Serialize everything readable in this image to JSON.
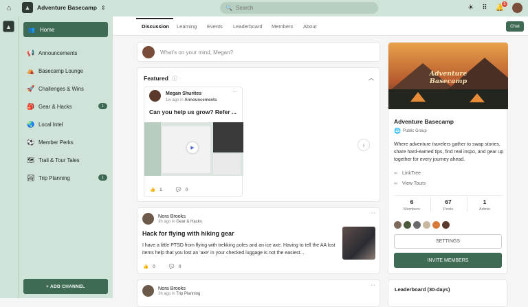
{
  "topbar": {
    "brand_title": "Adventure Basecamp",
    "search_placeholder": "Search",
    "notification_count": "5"
  },
  "sidebar": {
    "home_label": "Home",
    "items": [
      {
        "label": "Announcements",
        "icon": "megaphone-icon",
        "glyph": "📢",
        "count": ""
      },
      {
        "label": "Basecamp Lounge",
        "icon": "tent-icon",
        "glyph": "⛺",
        "count": ""
      },
      {
        "label": "Challenges & Wins",
        "icon": "rocket-icon",
        "glyph": "🚀",
        "count": ""
      },
      {
        "label": "Gear & Hacks",
        "icon": "backpack-icon",
        "glyph": "🎒",
        "count": "1"
      },
      {
        "label": "Local Intel",
        "icon": "globe-icon",
        "glyph": "🌏",
        "count": ""
      },
      {
        "label": "Member Perks",
        "icon": "soccer-ball-icon",
        "glyph": "⚽",
        "count": ""
      },
      {
        "label": "Trail & Tour Tales",
        "icon": "map-icon",
        "glyph": "🗺",
        "count": ""
      },
      {
        "label": "Trip Planning",
        "icon": "railway-icon",
        "glyph": "🏞",
        "count": "1"
      }
    ],
    "add_channel_label": "+ ADD CHANNEL"
  },
  "tabs": {
    "items": [
      "Discussion",
      "Learning",
      "Events",
      "Leaderboard",
      "Members",
      "About"
    ],
    "active": "Discussion",
    "chat_label": "Chat"
  },
  "composer": {
    "placeholder": "What's on your mind, Megan?"
  },
  "featured": {
    "title": "Featured",
    "post": {
      "author": "Megan Shurites",
      "time": "1w ago in",
      "channel": "Announcements",
      "title": "Can you help us grow? Refer ...",
      "likes": "1",
      "comments": "0"
    }
  },
  "posts": [
    {
      "author": "Nora Brooks",
      "time": "3h ago in",
      "channel": "Gear & Hacks",
      "title": "Hack for flying with hiking gear",
      "body": "I have a little PTSD from flying with trekking poles and an ice axe. Having to tell the AA lost items help that you lost an 'axe' in your checked luggage is not the easiest...",
      "likes": "0",
      "comments": "0"
    },
    {
      "author": "Nora Brooks",
      "time": "3h ago in",
      "channel": "Trip Planning"
    }
  ],
  "group": {
    "banner_title_line1": "Adventure",
    "banner_title_line2": "Basecamp",
    "name": "Adventure Basecamp",
    "type": "Public Group",
    "description": "Where adventure travelers gather to swap stories, share hard-earned tips, find real inspo, and gear up together for every journey ahead.",
    "links": [
      "LinkTree",
      "View Tours"
    ],
    "stats": [
      {
        "num": "6",
        "label": "Members"
      },
      {
        "num": "67",
        "label": "Posts"
      },
      {
        "num": "1",
        "label": "Admin"
      }
    ],
    "member_colors": [
      "#7b6a5c",
      "#4a5a3a",
      "#6a6a6a",
      "#c9b8a0",
      "#d87b3a",
      "#5a3a2c"
    ],
    "settings_label": "SETTINGS",
    "invite_label": "INVITE MEMBERS"
  },
  "leaderboard": {
    "title": "Leaderboard (30-days)"
  },
  "colors": {
    "accent": "#3f6b55",
    "sidebar_bg": "#cfe3d8"
  }
}
